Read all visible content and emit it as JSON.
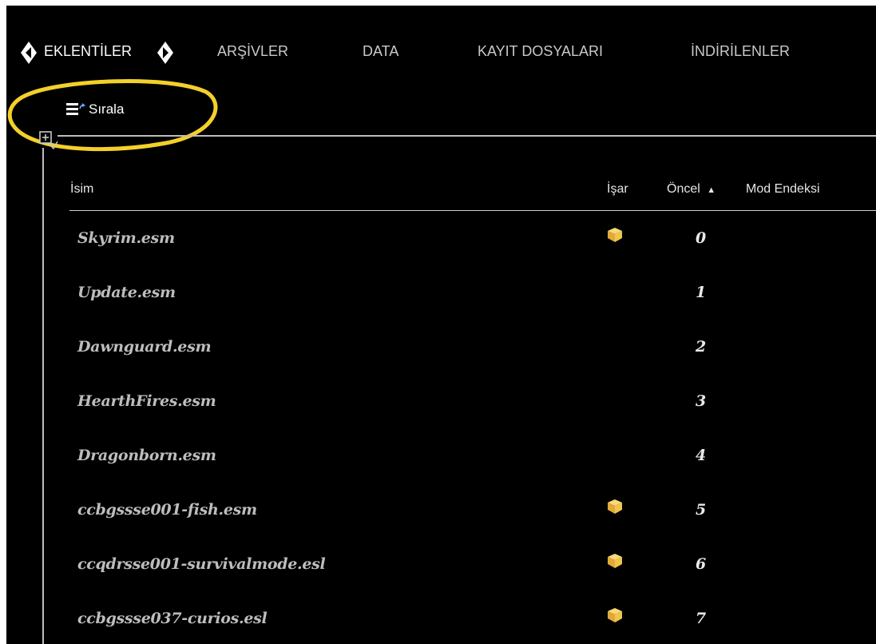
{
  "tabs": {
    "plugins": "EKLENTİLER",
    "archives": "ARŞİVLER",
    "data": "DATA",
    "saves": "KAYIT DOSYALARI",
    "downloads": "İNDİRİLENLER"
  },
  "toolbar": {
    "sort_label": "Sırala"
  },
  "table": {
    "headers": {
      "name": "İsim",
      "flags": "İşar",
      "priority": "Öncel",
      "priority_sort_indicator": "▲",
      "mod_index": "Mod Endeksi"
    },
    "rows": [
      {
        "name": "Skyrim.esm",
        "priority": "0",
        "flag": "package-icon"
      },
      {
        "name": "Update.esm",
        "priority": "1",
        "flag": ""
      },
      {
        "name": "Dawnguard.esm",
        "priority": "2",
        "flag": ""
      },
      {
        "name": "HearthFires.esm",
        "priority": "3",
        "flag": ""
      },
      {
        "name": "Dragonborn.esm",
        "priority": "4",
        "flag": ""
      },
      {
        "name": "ccbgssse001-fish.esm",
        "priority": "5",
        "flag": "package-icon"
      },
      {
        "name": "ccqdrsse001-survivalmode.esl",
        "priority": "6",
        "flag": "package-icon"
      },
      {
        "name": "ccbgssse037-curios.esl",
        "priority": "7",
        "flag": "package-icon"
      }
    ]
  },
  "colors": {
    "background": "#000000",
    "text": "#bdbdbd",
    "highlight": "#f3d02a",
    "package_icon": "#f0c64a"
  }
}
